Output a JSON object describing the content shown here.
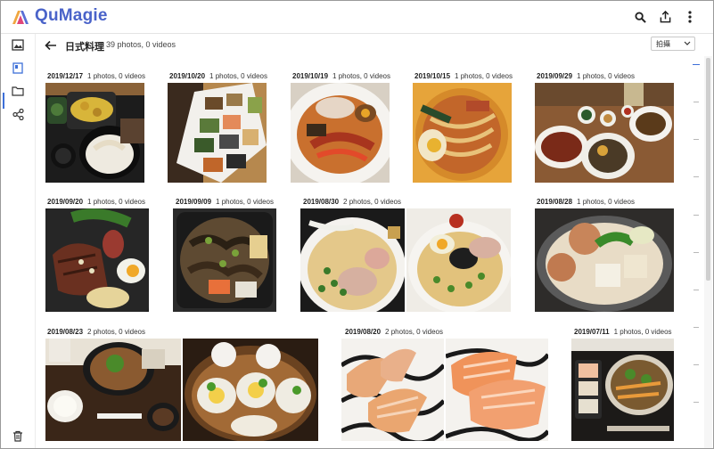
{
  "app": {
    "name": "QuMagie"
  },
  "album": {
    "title": "日式料理",
    "count": "39 photos, 0 videos",
    "sort_value": "拍攝"
  },
  "groups": [
    {
      "date": "2019/12/17",
      "count": "1 photos, 0 videos"
    },
    {
      "date": "2019/10/20",
      "count": "1 photos, 0 videos"
    },
    {
      "date": "2019/10/19",
      "count": "1 photos, 0 videos"
    },
    {
      "date": "2019/10/15",
      "count": "1 photos, 0 videos"
    },
    {
      "date": "2019/09/29",
      "count": "1 photos, 0 videos"
    },
    {
      "date": "2019/09/20",
      "count": "1 photos, 0 videos"
    },
    {
      "date": "2019/09/09",
      "count": "1 photos, 0 videos"
    },
    {
      "date": "2019/08/30",
      "count": "2 photos, 0 videos"
    },
    {
      "date": "2019/08/28",
      "count": "1 photos, 0 videos"
    },
    {
      "date": "2019/08/23",
      "count": "2 photos, 0 videos"
    },
    {
      "date": "2019/08/20",
      "count": "2 photos, 0 videos"
    },
    {
      "date": "2019/07/11",
      "count": "1 photos, 0 videos"
    }
  ],
  "icons": {
    "top": [
      "search-icon",
      "share-icon",
      "more-vert-icon"
    ],
    "rail": [
      "photos-icon",
      "album-icon",
      "folder-icon",
      "share-nodes-icon",
      "trash-icon"
    ]
  },
  "colors": {
    "brand": "#4a63c9",
    "accent": "#3d6fd8"
  }
}
